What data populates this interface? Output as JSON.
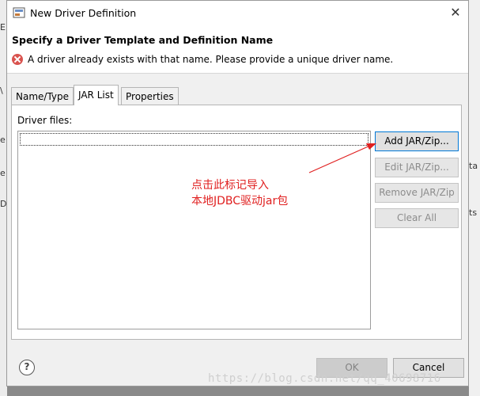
{
  "window": {
    "title": "New Driver Definition",
    "close_glyph": "✕"
  },
  "header": {
    "title": "Specify a Driver Template and Definition Name",
    "error_message": "A driver already exists with that name. Please provide a unique driver name."
  },
  "tabs": [
    {
      "label": "Name/Type",
      "active": false
    },
    {
      "label": "JAR List",
      "active": true
    },
    {
      "label": "Properties",
      "active": false
    }
  ],
  "jar_list": {
    "label": "Driver files:",
    "files": []
  },
  "buttons": {
    "add": "Add JAR/Zip...",
    "edit": "Edit JAR/Zip...",
    "remove": "Remove JAR/Zip",
    "clear": "Clear All",
    "ok": "OK",
    "cancel": "Cancel",
    "help": "?"
  },
  "annotation": {
    "line1": "点击此标记导入",
    "line2": "本地JDBC驱动jar包",
    "color": "#e02020"
  },
  "watermark": "https://blog.csdn.net/qq_40698716",
  "background_edge": {
    "left_texts": [
      "E",
      "\\",
      "e",
      "e",
      "Da"
    ],
    "right_texts": [
      "ta",
      "ts"
    ]
  },
  "icons": {
    "title": "driver-definition-icon",
    "error": "error-icon",
    "help": "help-icon",
    "close": "close-icon"
  }
}
